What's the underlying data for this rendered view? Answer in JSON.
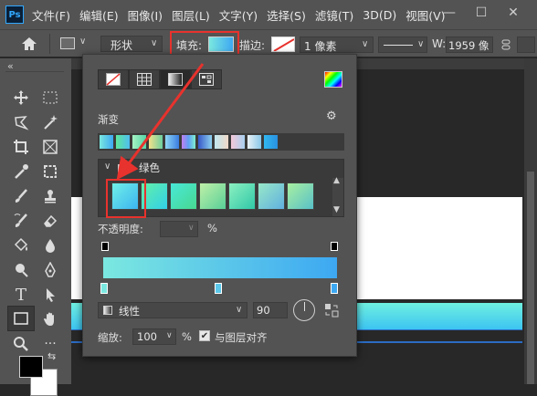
{
  "app": {
    "logo": "Ps"
  },
  "menubar": {
    "items": [
      "文件(F)",
      "编辑(E)",
      "图像(I)",
      "图层(L)",
      "文字(Y)",
      "选择(S)",
      "滤镜(T)",
      "3D(D)",
      "视图(V)"
    ],
    "window_buttons": [
      "—",
      "☐",
      "✕"
    ]
  },
  "optbar": {
    "mode_value": "形状",
    "fill_label": "填充:",
    "stroke_label": "描边:",
    "stroke_width_value": "1 像素",
    "w_label": "W:",
    "w_value": "1959 像"
  },
  "popup": {
    "gradient_header": "渐变",
    "group_name": "绿色",
    "opacity_label": "不透明度:",
    "opacity_unit": "%",
    "style_value": "线性",
    "angle_value": "90",
    "scale_label": "缩放:",
    "scale_value": "100",
    "scale_unit": "%",
    "align_label": "与图层对齐",
    "align_checked": "✔"
  },
  "colors": {
    "accent_red": "#e8322d",
    "gradient_start": "#7be8e0",
    "gradient_end": "#3da8f2"
  }
}
